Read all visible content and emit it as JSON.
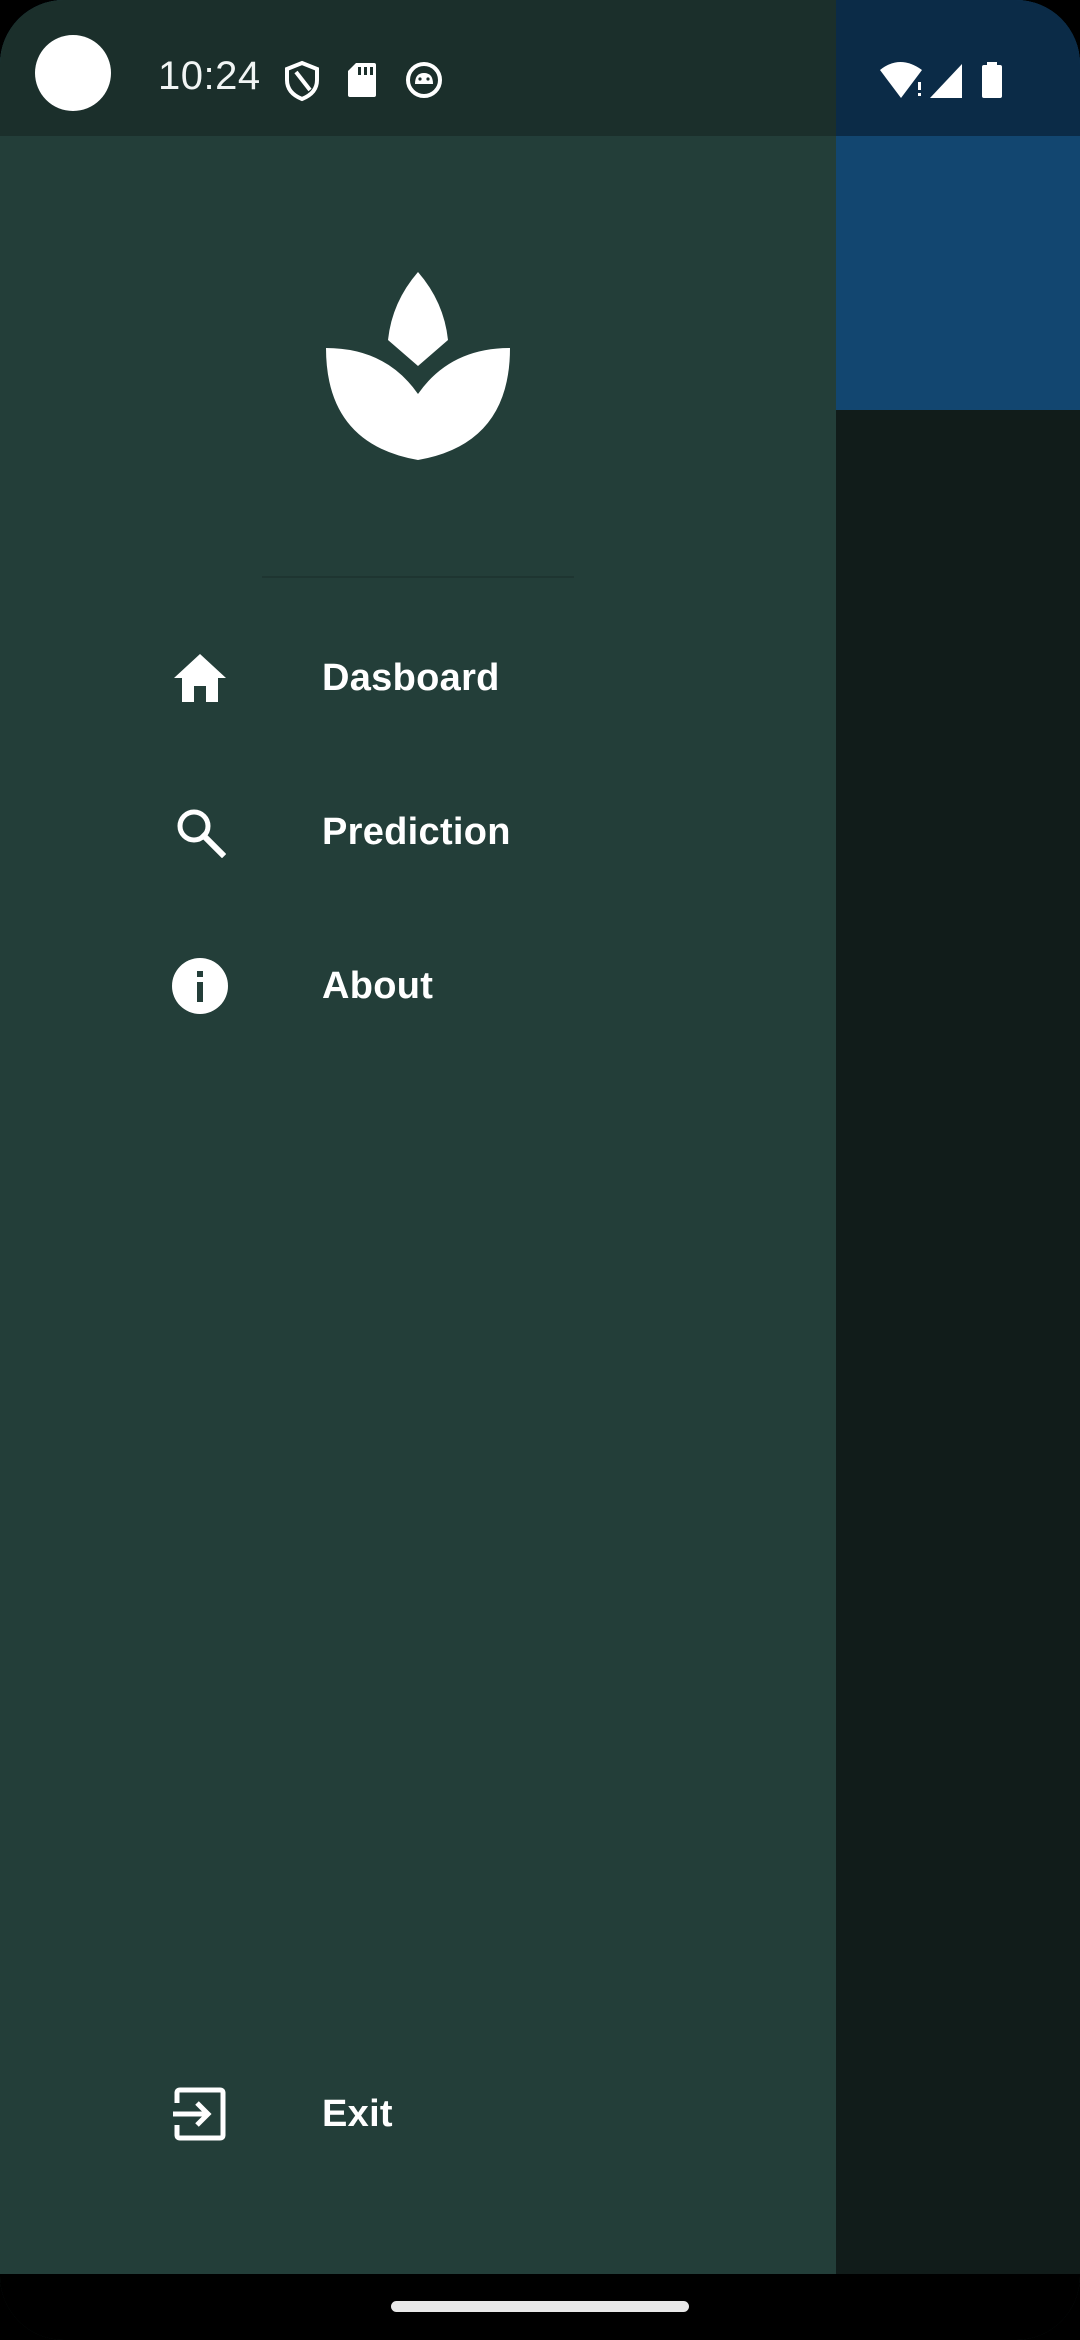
{
  "status_bar": {
    "time": "10:24",
    "left_icons": [
      "shield-icon",
      "sd-card-icon",
      "android-debug-icon"
    ],
    "right_icons": [
      "wifi-alert-icon",
      "signal-icon",
      "battery-icon"
    ]
  },
  "drawer": {
    "logo": "lotus-leaf-logo",
    "menu": [
      {
        "icon": "home-icon",
        "label": "Dasboard"
      },
      {
        "icon": "search-icon",
        "label": "Prediction"
      },
      {
        "icon": "info-icon",
        "label": "About"
      }
    ],
    "exit": {
      "icon": "exit-icon",
      "label": "Exit"
    }
  },
  "colors": {
    "drawer_bg": "#233e39",
    "drawer_status_bg": "#1b2f2b",
    "app_bar": "#124670",
    "scrim_body": "#111c1a",
    "text": "#ffffff"
  }
}
